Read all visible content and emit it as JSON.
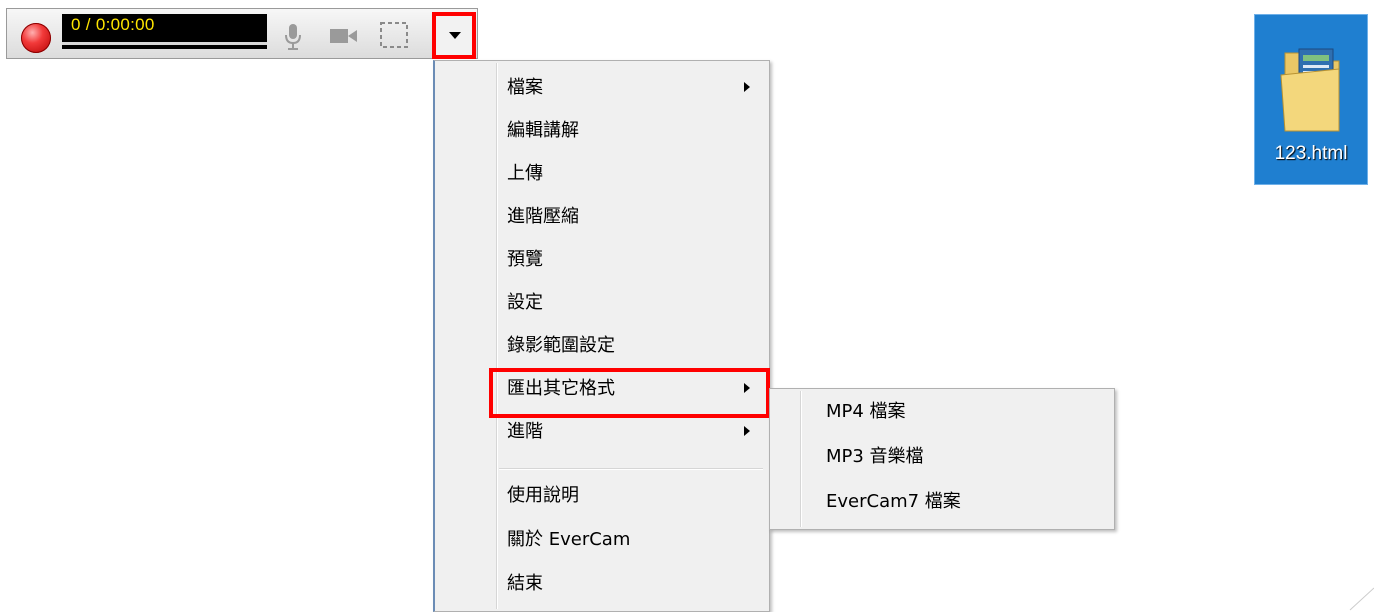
{
  "toolbar": {
    "time": "0 / 0:00:00",
    "icons": [
      "record-icon",
      "microphone-icon",
      "camera-icon",
      "region-select-icon",
      "dropdown-arrow-icon"
    ]
  },
  "menu": {
    "items": [
      {
        "label": "檔案",
        "has_submenu": true
      },
      {
        "label": "編輯講解",
        "has_submenu": false
      },
      {
        "label": "上傳",
        "has_submenu": false
      },
      {
        "label": "進階壓縮",
        "has_submenu": false
      },
      {
        "label": "預覽",
        "has_submenu": false
      },
      {
        "label": "設定",
        "has_submenu": false
      },
      {
        "label": "錄影範圍設定",
        "has_submenu": false
      },
      {
        "label": "匯出其它格式",
        "has_submenu": true,
        "highlighted": true
      },
      {
        "label": "進階",
        "has_submenu": true
      },
      {
        "label": "使用說明",
        "has_submenu": false
      },
      {
        "label": "關於 EverCam",
        "has_submenu": false
      },
      {
        "label": "結束",
        "has_submenu": false
      }
    ]
  },
  "submenu": {
    "items": [
      {
        "label": "MP4 檔案"
      },
      {
        "label": "MP3 音樂檔"
      },
      {
        "label": "EverCam7 檔案"
      }
    ]
  },
  "desktop_icon": {
    "label": "123.html",
    "icon": "folder-icon"
  },
  "colors": {
    "highlight": "#ff0000",
    "time_text": "#ffe600",
    "desktop_icon_bg": "#1f7fd0",
    "menu_bg": "#f0f0f0"
  }
}
